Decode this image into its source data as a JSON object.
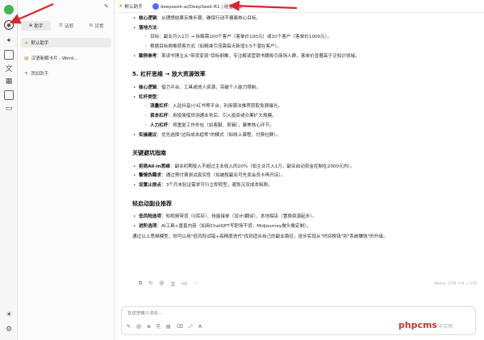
{
  "topbar": {
    "assistant_label": "默认助手",
    "model_label": "deepseek-ai/DeepSeek-R1 | 硅基流动"
  },
  "panel": {
    "tabs": [
      {
        "label": "助手"
      },
      {
        "label": "话题"
      },
      {
        "label": "设置"
      }
    ],
    "items": [
      {
        "label": "默认助手"
      },
      {
        "label": "汉语新解卡片 - Word..."
      },
      {
        "label": "添加助手"
      }
    ]
  },
  "content": {
    "sec4_tail": [
      {
        "b": "核心逻辑",
        "t": "：从理想结果反推步骤，确保行动不偏离核心目标。"
      },
      {
        "b": "落地方法",
        "t": "："
      }
    ],
    "sec4_sub": [
      "目标：副业月入1万 → 拆解需100个客户（客单价100元）或10个客户（客单价1000元）。",
      "根据目标倒推获客方式（如精准引流需每天新增3-5个潜在客户）。"
    ],
    "sec4_case": {
      "b": "案例参考",
      "t": "：某读书博主从\"带货变现\"目标倒推，专注解读营销书籍吸引商场人群，客单价显著高于泛知识领域。"
    },
    "h5": "5. 杠杆思维 → 放大资源效率",
    "sec5_a": [
      {
        "b": "核心逻辑",
        "t": "：借力平台、工具或他人资源，突破个人能力限制。"
      },
      {
        "b": "杠杆类型",
        "t": "："
      }
    ],
    "sec5_sub": [
      {
        "b": "流量杠杆",
        "t": "：入驻抖音/小红书等平台，利用算法推荐获取免费曝光。"
      },
      {
        "b": "资本杠杆",
        "t": "：用投简借贷测通业务后，引入投资或众筹扩大规模。"
      },
      {
        "b": "人力杠杆",
        "t": "：将重复工作外包（如客服、剪辑），聚焦核心环节。"
      }
    ],
    "sec5_b": {
      "b": "实操建议",
      "t": "：优先选择\"边际成本趋零\"的模式（如线上课程、付费社群）。"
    },
    "h_pit": "关键避坑指南",
    "pit": [
      {
        "b": "拒绝All-in思维",
        "t": "：副业初期投入不超过主业收入的20%（如主业月入1万，副业启动资金控制在2000元内）。"
      },
      {
        "b": "警惕伪需求",
        "t": "：通过预付费测试真实性（如被叙副业可先卖会员卡再开店）。"
      },
      {
        "b": "设置止损点",
        "t": "：3个月未验证需求可行立即转型，避免沉没成本陷阱。"
      }
    ],
    "h_rec": "轻启动副业推荐",
    "rec": [
      {
        "b": "低风险选项",
        "t": "：知视频带货（0库存）、技能接单（设计/翻译）、本地探店（置换资源起步）。"
      },
      {
        "b": "进阶选项",
        "t": "：AI工具+垂直内容（如用ChatGPT写职场干货，Midjourney做头像定制）。"
      }
    ],
    "conclusion": "通过以上思维模型，你可以用\"低风险试错+高精度迭代\"找到适合自己的副业路径，逐步实现从\"时间换钱\"到\"系统赚钱\"的升级。"
  },
  "tokens": "Tokens: 1728 ↑24 ↓1704",
  "input": {
    "placeholder": "在这里输入消息..."
  },
  "watermark": {
    "brand": "phpcms",
    "sub": "中文网"
  },
  "colors": {
    "accent_blue": "#4d6bfe",
    "arrow_red": "#d9262b",
    "watermark_red": "#c0392b"
  }
}
